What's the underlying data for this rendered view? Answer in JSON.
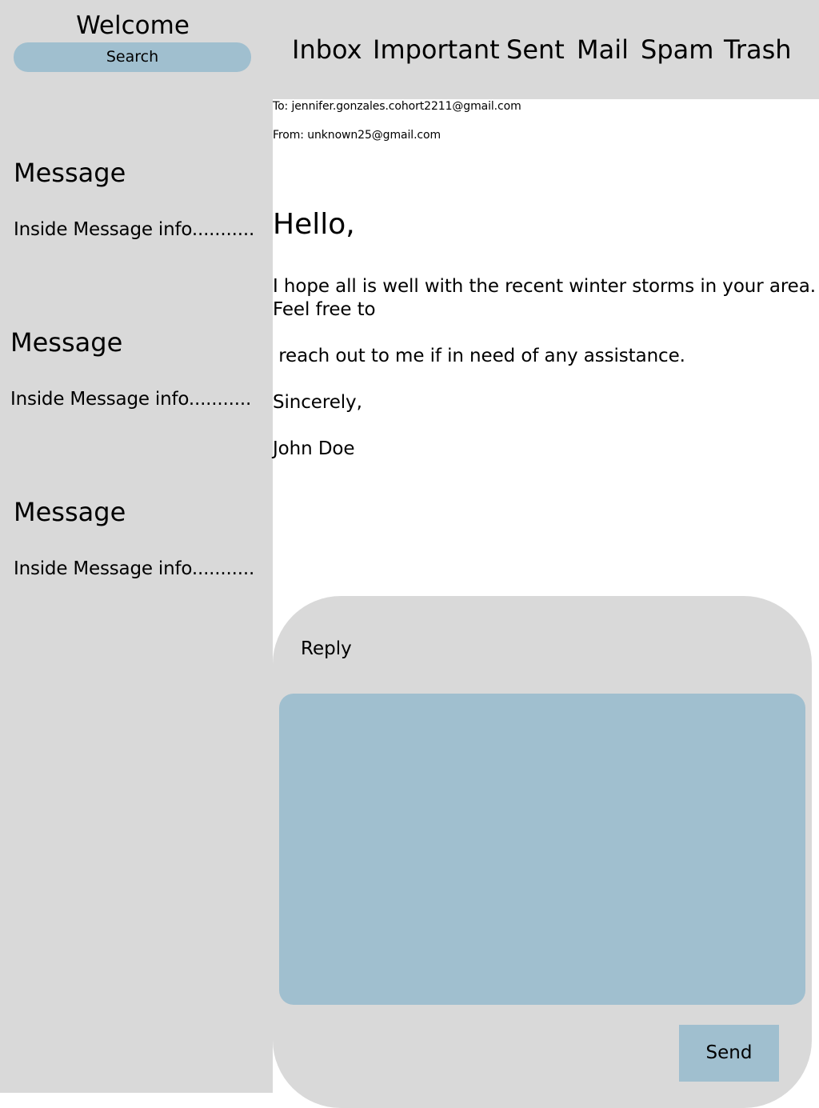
{
  "sidebar": {
    "welcome": "Welcome",
    "search_label": "Search",
    "messages": [
      {
        "title": "Message",
        "info": "Inside Message info..........."
      },
      {
        "title": "Message",
        "info": "Inside Message info..........."
      },
      {
        "title": "Message",
        "info": "Inside Message info..........."
      }
    ]
  },
  "nav": {
    "items": [
      "Inbox",
      "Important",
      "Sent",
      "Mail",
      "Spam",
      "Trash"
    ]
  },
  "email": {
    "to": "To: jennifer.gonzales.cohort2211@gmail.com",
    "from": "From: unknown25@gmail.com",
    "greeting": "Hello,",
    "body_line1": "I hope all is well with the recent winter storms in your area.",
    "body_line2": "Feel free to",
    "body_line3": " reach out to me if in need of any assistance.",
    "closing": "Sincerely,",
    "signature": "John Doe"
  },
  "reply": {
    "label": "Reply",
    "placeholder": "",
    "send_label": "Send"
  },
  "colors": {
    "panel_gray": "#d9d9d9",
    "accent_blue": "#a0bfcf",
    "background": "#ffffff"
  }
}
